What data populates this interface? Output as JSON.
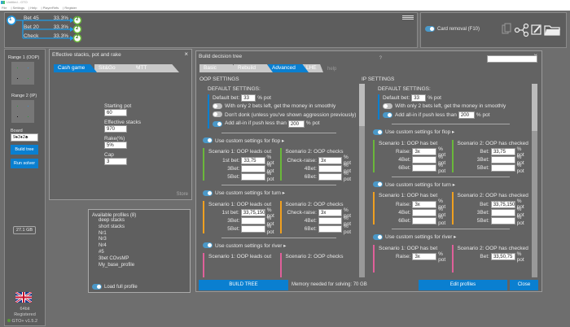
{
  "window": {
    "title": "Untitled - GTO",
    "menu": [
      "File",
      "Settings",
      "Help",
      "PlayerRefs",
      "Register"
    ]
  },
  "tree": {
    "root": "1",
    "branches": [
      {
        "label": "Bet 45",
        "pct": "33.3%",
        "node": "2"
      },
      {
        "label": "Bet 20",
        "pct": "33.3%",
        "node": "2"
      },
      {
        "label": "Check",
        "pct": "33.3%",
        "node": "2"
      }
    ]
  },
  "tools": {
    "card_removal": "Card removal (F10)",
    "card_removal_on": true
  },
  "sidebar": {
    "range1": "Range 1 (OOP)",
    "range2": "Range 2 (IP)",
    "board_label": "Board",
    "board": "9♠3♦2♣",
    "build_tree": "Build tree",
    "run_solver": "Run solver",
    "memory": "27.1 GB",
    "bits": "64bit",
    "registered": "Registered",
    "version": "GTO+ v1.5.2"
  },
  "stacks": {
    "title": "Effective stacks, pot and rake",
    "tabs": [
      "Cash game",
      "Sit&Go",
      "MTT"
    ],
    "active_tab": "Cash game",
    "fields": [
      {
        "label": "Starting pot",
        "value": "60"
      },
      {
        "label": "Effective stacks",
        "value": "970"
      },
      {
        "label": "Rake(%)",
        "value": "5%"
      },
      {
        "label": "Cap",
        "value": "3"
      }
    ],
    "store": "Store"
  },
  "profiles": {
    "title": "Available profiles (8)",
    "items": [
      "deep stacks",
      "short stacks",
      "Nr1",
      "Nr3",
      "Nr4",
      "#5",
      "3bet COvsMP",
      "My_base_profile"
    ],
    "load_full": "Load full profile",
    "load_full_on": true
  },
  "builder": {
    "title": "Build decision tree",
    "tabs": [
      "Basic",
      "Rebuild",
      "Advanced",
      "LHE"
    ],
    "active_tab": "Advanced",
    "help": "help",
    "search_hint": "?",
    "search_value": "",
    "build_tree": "BUILD TREE",
    "memory": "Memory needed for solving: 70 GB",
    "edit_profiles": "Edit profiles",
    "close": "Close",
    "colors": {
      "flop": "#6ab83a",
      "turn": "#f0a020",
      "river": "#e0609a",
      "accent": "#0a7fd0"
    },
    "oop": {
      "heading": "OOP SETTINGS",
      "default_label": "DEFAULT SETTINGS:",
      "default_bet": {
        "label": "Default bet:",
        "value": "33",
        "unit": "% pot"
      },
      "toggles": [
        {
          "label": "With only 2 bets left, get the money in smoothly",
          "on": false
        },
        {
          "label": "Don't donk (unless you've shown aggression previously)",
          "on": false
        }
      ],
      "allin": {
        "label": "Add all-in if push less than",
        "value": "200",
        "unit": "% pot",
        "on": true
      },
      "streets": [
        {
          "key": "flop",
          "label": "Use custom settings for flop ▸",
          "on": true,
          "scenarios": [
            {
              "title": "Scenario 1: OOP leads out",
              "rows": [
                {
                  "label": "1st bet:",
                  "value": "33,75",
                  "unit": "% pot"
                },
                {
                  "label": "3Bet:",
                  "value": "",
                  "unit": "% pot"
                },
                {
                  "label": "5Bet:",
                  "value": "",
                  "unit": "% pot"
                }
              ]
            },
            {
              "title": "Scenario 2: OOP checks",
              "rows": [
                {
                  "label": "Check-raise:",
                  "value": "3x",
                  "unit": "% pot"
                },
                {
                  "label": "4Bet:",
                  "value": "",
                  "unit": "% pot"
                },
                {
                  "label": "6Bet:",
                  "value": "",
                  "unit": "% pot"
                }
              ]
            }
          ]
        },
        {
          "key": "turn",
          "label": "Use custom settings for turn ▸",
          "on": true,
          "scenarios": [
            {
              "title": "Scenario 1: OOP leads out",
              "rows": [
                {
                  "label": "1st bet:",
                  "value": "33,75,150",
                  "unit": "% pot"
                },
                {
                  "label": "3Bet:",
                  "value": "",
                  "unit": "% pot"
                },
                {
                  "label": "5Bet:",
                  "value": "",
                  "unit": "% pot"
                }
              ]
            },
            {
              "title": "Scenario 2: OOP checks",
              "rows": [
                {
                  "label": "Check-raise:",
                  "value": "3x",
                  "unit": "% pot"
                },
                {
                  "label": "4Bet:",
                  "value": "",
                  "unit": "% pot"
                },
                {
                  "label": "6Bet:",
                  "value": "",
                  "unit": "% pot"
                }
              ]
            }
          ]
        },
        {
          "key": "river",
          "label": "Use custom settings for river ▸",
          "on": true,
          "scenarios": [
            {
              "title": "Scenario 1: OOP leads out",
              "rows": []
            },
            {
              "title": "Scenario 2: OOP checks",
              "rows": []
            }
          ]
        }
      ]
    },
    "ip": {
      "heading": "IP SETTINGS",
      "default_label": "DEFAULT SETTINGS:",
      "default_bet": {
        "label": "Default bet:",
        "value": "33",
        "unit": "% pot"
      },
      "toggles": [
        {
          "label": "With only 2 bets left, get the money in smoothly",
          "on": false
        }
      ],
      "allin": {
        "label": "Add all-in if push less than",
        "value": "200",
        "unit": "% pot",
        "on": true
      },
      "streets": [
        {
          "key": "flop",
          "label": "Use custom settings for flop ▸",
          "on": true,
          "scenarios": [
            {
              "title": "Scenario 1: OOP has bet",
              "rows": [
                {
                  "label": "Raise:",
                  "value": "3x",
                  "unit": "% pot"
                },
                {
                  "label": "4Bet:",
                  "value": "",
                  "unit": "% pot"
                },
                {
                  "label": "6Bet:",
                  "value": "",
                  "unit": "% pot"
                }
              ]
            },
            {
              "title": "Scenario 2: OOP has checked",
              "rows": [
                {
                  "label": "Bet:",
                  "value": "33,75",
                  "unit": "% pot"
                },
                {
                  "label": "3Bet:",
                  "value": "",
                  "unit": "% pot"
                },
                {
                  "label": "5Bet:",
                  "value": "",
                  "unit": "% pot"
                }
              ]
            }
          ]
        },
        {
          "key": "turn",
          "label": "Use custom settings for turn ▸",
          "on": true,
          "scenarios": [
            {
              "title": "Scenario 1: OOP has bet",
              "rows": [
                {
                  "label": "Raise:",
                  "value": "3x",
                  "unit": "% pot"
                },
                {
                  "label": "4Bet:",
                  "value": "",
                  "unit": "% pot"
                },
                {
                  "label": "6Bet:",
                  "value": "",
                  "unit": "% pot"
                }
              ]
            },
            {
              "title": "Scenario 2: OOP has checked",
              "rows": [
                {
                  "label": "Bet:",
                  "value": "33,75,150",
                  "unit": "% pot"
                },
                {
                  "label": "3Bet:",
                  "value": "",
                  "unit": "% pot"
                },
                {
                  "label": "5Bet:",
                  "value": "",
                  "unit": "% pot"
                }
              ]
            }
          ]
        },
        {
          "key": "river",
          "label": "Use custom settings for river ▸",
          "on": true,
          "scenarios": [
            {
              "title": "Scenario 1: OOP has bet",
              "rows": [
                {
                  "label": "Raise:",
                  "value": "3x",
                  "unit": "% pot"
                }
              ]
            },
            {
              "title": "Scenario 2: OOP has checked",
              "rows": [
                {
                  "label": "Bet:",
                  "value": "33,50,75",
                  "unit": "% pot"
                }
              ]
            }
          ]
        }
      ]
    }
  }
}
